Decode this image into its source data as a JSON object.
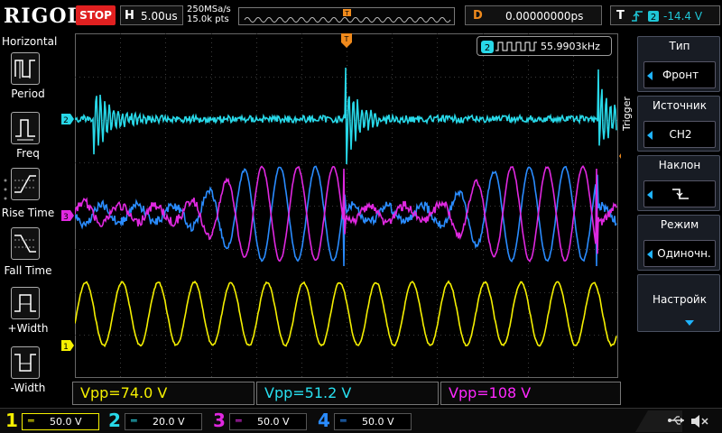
{
  "top": {
    "logo": "RIGOL",
    "run_state": "STOP",
    "horizontal_key": "H",
    "timebase": "5.00us",
    "sample_rate": "250MSa/s",
    "memory_depth": "15.0k pts",
    "delay_key": "D",
    "delay": "0.00000000ps",
    "trigger_key": "T",
    "trigger_level": "-14.4 V"
  },
  "left_menu": {
    "title": "Horizontal",
    "items": [
      {
        "label": "Period"
      },
      {
        "label": "Freq"
      },
      {
        "label": "Rise Time"
      },
      {
        "label": "Fall Time"
      },
      {
        "label": "+Width"
      },
      {
        "label": "-Width"
      }
    ]
  },
  "frequency_readout": {
    "channel": "2",
    "value": "55.9903kHz"
  },
  "channel_markers": {
    "ch2": "2",
    "ch3": "3",
    "ch1": "1",
    "trigger": "T"
  },
  "trigger_menu": {
    "label": "Trigger",
    "groups": [
      {
        "title": "Тип",
        "value": "Фронт"
      },
      {
        "title": "Источник",
        "value": "CH2"
      },
      {
        "title": "Наклон",
        "value": ""
      },
      {
        "title": "Режим",
        "value": "Одиночн."
      },
      {
        "title": "Настройк",
        "value": ""
      }
    ]
  },
  "measurements": [
    {
      "text": "Vpp=74.0 V",
      "color": "#f5f000"
    },
    {
      "text": "Vpp=51.2 V",
      "color": "#28e0f0"
    },
    {
      "text": "Vpp=108 V",
      "color": "#ff28ff"
    }
  ],
  "channels": [
    {
      "num": "1",
      "scale": "50.0 V",
      "color": "#f5f000"
    },
    {
      "num": "2",
      "scale": "20.0 V",
      "color": "#28d8e8"
    },
    {
      "num": "3",
      "scale": "50.0 V",
      "color": "#e028e0"
    },
    {
      "num": "4",
      "scale": "50.0 V",
      "color": "#2a8cff"
    }
  ],
  "colors": {
    "ch1": "#f5f000",
    "ch2": "#28d8e8",
    "ch3": "#e028e0",
    "ch4": "#2a8cff",
    "trigger": "#f08a1c",
    "stop": "#e02020"
  }
}
